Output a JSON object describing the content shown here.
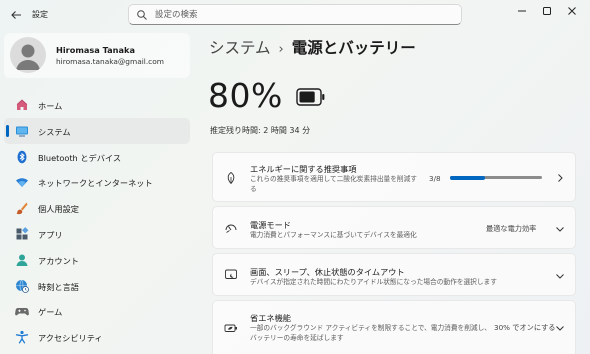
{
  "window": {
    "title": "設定"
  },
  "search": {
    "placeholder": "設定の検索"
  },
  "profile": {
    "name": "Hiromasa Tanaka",
    "email": "hiromasa.tanaka@gmail.com"
  },
  "nav": {
    "items": [
      {
        "label": "ホーム",
        "icon": "home-icon"
      },
      {
        "label": "システム",
        "icon": "system-icon",
        "active": true
      },
      {
        "label": "Bluetooth とデバイス",
        "icon": "bluetooth-icon"
      },
      {
        "label": "ネットワークとインターネット",
        "icon": "wifi-icon"
      },
      {
        "label": "個人用設定",
        "icon": "brush-icon"
      },
      {
        "label": "アプリ",
        "icon": "apps-icon"
      },
      {
        "label": "アカウント",
        "icon": "account-icon"
      },
      {
        "label": "時刻と言語",
        "icon": "globe-clock-icon"
      },
      {
        "label": "ゲーム",
        "icon": "gamepad-icon"
      },
      {
        "label": "アクセシビリティ",
        "icon": "accessibility-icon"
      }
    ]
  },
  "breadcrumb": {
    "parent": "システム",
    "separator": "›",
    "current": "電源とバッテリー"
  },
  "battery": {
    "percent": "80%",
    "level": 0.8,
    "remaining": "推定残り時間: 2 時間 34 分"
  },
  "cards": {
    "energy": {
      "title": "エネルギーに関する推奨事項",
      "desc": "これらの推奨事項を適用して二酸化炭素排出量を削減する",
      "value": "3/8",
      "progress": 0.375
    },
    "power_mode": {
      "title": "電源モード",
      "desc": "電力消費とパフォーマンスに基づいてデバイスを最適化",
      "value": "最適な電力効率"
    },
    "screen_sleep": {
      "title": "画面、スリープ、休止状態のタイムアウト",
      "desc": "デバイスが指定された時間にわたりアイドル状態になった場合の動作を選択します"
    },
    "energy_saver": {
      "title": "省エネ機能",
      "desc": "一部のバックグラウンド アクティビティを制限することで、電力消費を削減し、バッテリーの寿命を延ばします",
      "value": "30% でオンにする"
    }
  },
  "colors": {
    "accent": "#0067c0"
  }
}
